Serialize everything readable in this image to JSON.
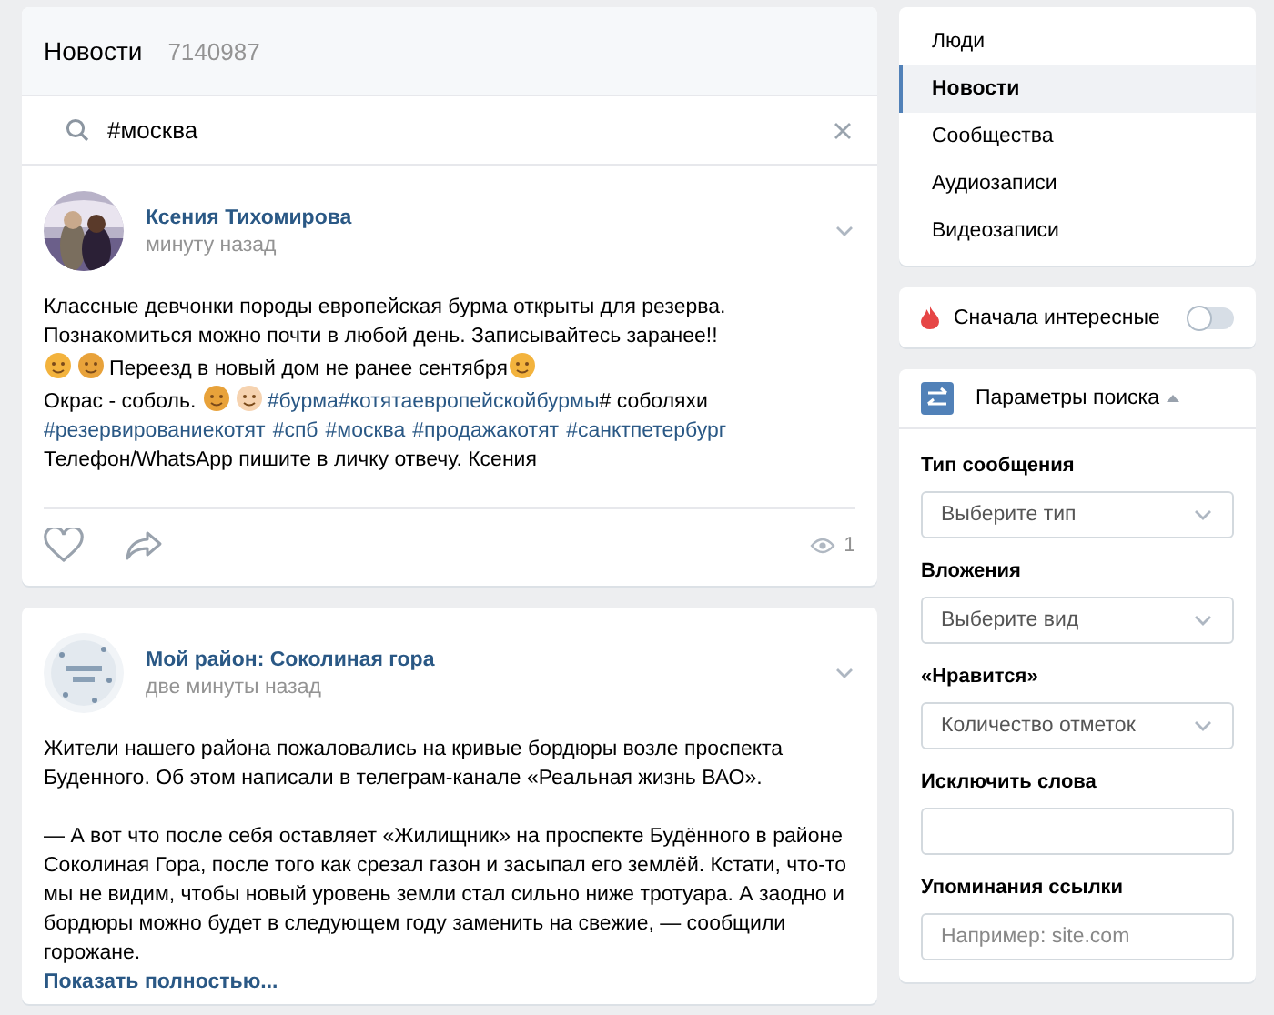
{
  "header": {
    "title": "Новости",
    "count": "7140987"
  },
  "search": {
    "value": "#москва"
  },
  "posts": [
    {
      "author": "Ксения Тихомирова",
      "time": "минуту назад",
      "lines": [
        [
          {
            "kind": "text",
            "text": "Классные девчонки породы европейская бурма открыты для резерва."
          }
        ],
        [
          {
            "kind": "text",
            "text": "Познакомиться можно почти в любой день. Записывайтесь заранее!!"
          }
        ],
        [
          {
            "kind": "emoji"
          },
          {
            "kind": "emoji"
          },
          {
            "kind": "text",
            "text": "Переезд в новый дом не ранее сентября"
          },
          {
            "kind": "emoji"
          }
        ],
        [
          {
            "kind": "text",
            "text": "Окрас - соболь. "
          },
          {
            "kind": "emoji"
          },
          {
            "kind": "emoji"
          },
          {
            "kind": "tag",
            "text": "#бурма"
          },
          {
            "kind": "tag",
            "text": "#котятаевропейскойбурмы"
          },
          {
            "kind": "text",
            "text": "# соболяхи"
          }
        ],
        [
          {
            "kind": "tags",
            "items": [
              "#резервированиекотят",
              "#спб",
              "#москва",
              "#продажакотят",
              "#санктпетербург"
            ]
          }
        ],
        [
          {
            "kind": "text",
            "text": "Телефон/WhatsApp пишите в личку отвечу. Ксения"
          }
        ]
      ],
      "views": "1"
    },
    {
      "author": "Мой район: Соколиная гора",
      "time": "две минуты назад",
      "paragraphs": [
        "Жители нашего района пожаловались на кривые бордюры возле проспекта Буденного. Об этом написали в телеграм-канале «Реальная жизнь ВАО».",
        "— А вот что после себя оставляет «Жилищник» на проспекте Будённого в районе Соколиная Гора, после того как срезал газон и засыпал его землёй. Кстати, что-то мы не видим, чтобы новый уровень земли стал сильно ниже тротуара. А заодно и бордюры можно будет в следующем году заменить на свежие, — сообщили горожане."
      ],
      "more": "Показать полностью..."
    }
  ],
  "menu": [
    {
      "label": "Люди",
      "selected": false
    },
    {
      "label": "Новости",
      "selected": true
    },
    {
      "label": "Сообщества",
      "selected": false
    },
    {
      "label": "Аудиозаписи",
      "selected": false
    },
    {
      "label": "Видеозаписи",
      "selected": false
    }
  ],
  "interesting": {
    "label": "Сначала интересные",
    "on": false
  },
  "params": {
    "title": "Параметры поиска",
    "fields": [
      {
        "label": "Тип сообщения",
        "kind": "select",
        "value": "Выберите тип"
      },
      {
        "label": "Вложения",
        "kind": "select",
        "value": "Выберите вид"
      },
      {
        "label": "«Нравится»",
        "kind": "select",
        "value": "Количество отметок"
      },
      {
        "label": "Исключить слова",
        "kind": "input"
      },
      {
        "label": "Упоминания ссылки",
        "kind": "input",
        "placeholder": "Например: site.com"
      }
    ]
  }
}
